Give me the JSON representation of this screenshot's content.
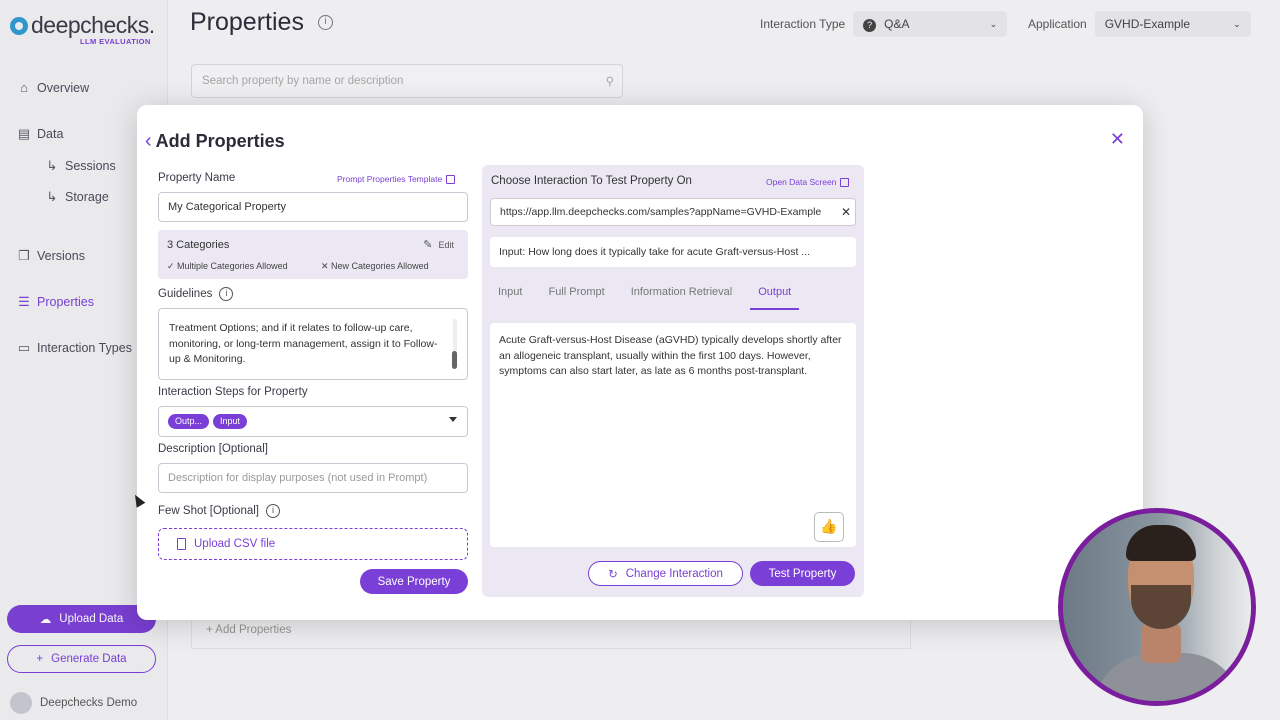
{
  "app": {
    "logo_text": "deepchecks.",
    "logo_sub": "LLM EVALUATION"
  },
  "sidebar": {
    "items": [
      {
        "label": "Overview",
        "icon": "home-icon"
      },
      {
        "label": "Data",
        "icon": "table-icon"
      },
      {
        "label": "Sessions",
        "icon": "sub-arrow-icon"
      },
      {
        "label": "Storage",
        "icon": "sub-arrow-icon"
      },
      {
        "label": "Versions",
        "icon": "copy-icon"
      },
      {
        "label": "Properties",
        "icon": "sliders-icon",
        "active": true
      },
      {
        "label": "Interaction Types",
        "icon": "chat-icon"
      }
    ],
    "upload_label": "Upload Data",
    "generate_label": "Generate Data",
    "user_name": "Deepchecks Demo"
  },
  "header": {
    "title": "Properties",
    "interaction_type_label": "Interaction Type",
    "interaction_type_value": "Q&A",
    "application_label": "Application",
    "application_value": "GVHD-Example",
    "search_placeholder": "Search property by name or description",
    "add_properties_row": "Add Properties"
  },
  "modal": {
    "title": "Add Properties",
    "property_name_label": "Property Name",
    "prompt_template_link": "Prompt Properties Template",
    "property_name_value": "My Categorical Property",
    "categories_title": "3 Categories",
    "edit_label": "Edit",
    "multiple_allowed": "✓ Multiple Categories Allowed",
    "new_allowed": "✕ New Categories Allowed",
    "guidelines_label": "Guidelines",
    "guidelines_text": "Treatment Options; and if it relates to follow-up care, monitoring, or long-term management, assign it to Follow-up & Monitoring.",
    "steps_label": "Interaction Steps for Property",
    "steps_chips": [
      "Outp...",
      "Input"
    ],
    "description_label": "Description [Optional]",
    "description_placeholder": "Description for display purposes (not used in Prompt)",
    "few_shot_label": "Few Shot [Optional]",
    "upload_csv_label": "Upload CSV file",
    "save_label": "Save Property"
  },
  "test_panel": {
    "title": "Choose Interaction To Test Property On",
    "open_data_link": "Open Data Screen",
    "url_value": "https://app.llm.deepchecks.com/samples?appName=GVHD-Example",
    "input_preview": "Input:  How long does it typically take for acute Graft-versus-Host ...",
    "tabs": [
      "Input",
      "Full Prompt",
      "Information Retrieval",
      "Output"
    ],
    "active_tab": "Output",
    "output_text": "Acute Graft-versus-Host Disease (aGVHD) typically develops shortly after an allogeneic transplant, usually within the first 100 days. However, symptoms can also start later, as late as 6 months post-transplant.",
    "change_label": "Change Interaction",
    "test_label": "Test Property"
  },
  "colors": {
    "accent": "#7a3fd6",
    "panel_bg": "#ebe8f3",
    "thumb_green": "#2aa84a"
  }
}
